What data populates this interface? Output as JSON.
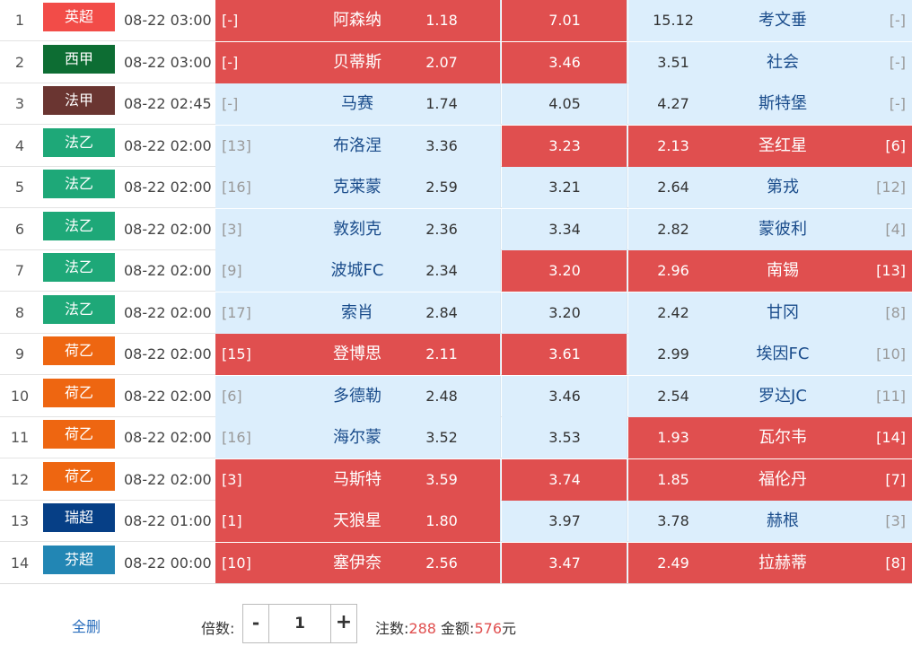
{
  "rows": [
    {
      "idx": "1",
      "league": "英超",
      "color": "#f24c48",
      "time": "08-22 03:00",
      "home_rank": "[-]",
      "home": "阿森纳",
      "home_odd": "1.18",
      "draw_odd": "7.01",
      "away_odd": "15.12",
      "away": "考文垂",
      "away_rank": "[-]",
      "sel_home": true,
      "sel_draw": true,
      "sel_away": false
    },
    {
      "idx": "2",
      "league": "西甲",
      "color": "#0d6d33",
      "time": "08-22 03:00",
      "home_rank": "[-]",
      "home": "贝蒂斯",
      "home_odd": "2.07",
      "draw_odd": "3.46",
      "away_odd": "3.51",
      "away": "社会",
      "away_rank": "[-]",
      "sel_home": true,
      "sel_draw": true,
      "sel_away": false
    },
    {
      "idx": "3",
      "league": "法甲",
      "color": "#6a3531",
      "time": "08-22 02:45",
      "home_rank": "[-]",
      "home": "马赛",
      "home_odd": "1.74",
      "draw_odd": "4.05",
      "away_odd": "4.27",
      "away": "斯特堡",
      "away_rank": "[-]",
      "sel_home": false,
      "sel_draw": false,
      "sel_away": false
    },
    {
      "idx": "4",
      "league": "法乙",
      "color": "#1ea878",
      "time": "08-22 02:00",
      "home_rank": "[13]",
      "home": "布洛涅",
      "home_odd": "3.36",
      "draw_odd": "3.23",
      "away_odd": "2.13",
      "away": "圣红星",
      "away_rank": "[6]",
      "sel_home": false,
      "sel_draw": true,
      "sel_away": true
    },
    {
      "idx": "5",
      "league": "法乙",
      "color": "#1ea878",
      "time": "08-22 02:00",
      "home_rank": "[16]",
      "home": "克莱蒙",
      "home_odd": "2.59",
      "draw_odd": "3.21",
      "away_odd": "2.64",
      "away": "第戎",
      "away_rank": "[12]",
      "sel_home": false,
      "sel_draw": false,
      "sel_away": false
    },
    {
      "idx": "6",
      "league": "法乙",
      "color": "#1ea878",
      "time": "08-22 02:00",
      "home_rank": "[3]",
      "home": "敦刻克",
      "home_odd": "2.36",
      "draw_odd": "3.34",
      "away_odd": "2.82",
      "away": "蒙彼利",
      "away_rank": "[4]",
      "sel_home": false,
      "sel_draw": false,
      "sel_away": false
    },
    {
      "idx": "7",
      "league": "法乙",
      "color": "#1ea878",
      "time": "08-22 02:00",
      "home_rank": "[9]",
      "home": "波城FC",
      "home_odd": "2.34",
      "draw_odd": "3.20",
      "away_odd": "2.96",
      "away": "南锡",
      "away_rank": "[13]",
      "sel_home": false,
      "sel_draw": true,
      "sel_away": true
    },
    {
      "idx": "8",
      "league": "法乙",
      "color": "#1ea878",
      "time": "08-22 02:00",
      "home_rank": "[17]",
      "home": "索肖",
      "home_odd": "2.84",
      "draw_odd": "3.20",
      "away_odd": "2.42",
      "away": "甘冈",
      "away_rank": "[8]",
      "sel_home": false,
      "sel_draw": false,
      "sel_away": false
    },
    {
      "idx": "9",
      "league": "荷乙",
      "color": "#ee6611",
      "time": "08-22 02:00",
      "home_rank": "[15]",
      "home": "登博思",
      "home_odd": "2.11",
      "draw_odd": "3.61",
      "away_odd": "2.99",
      "away": "埃因FC",
      "away_rank": "[10]",
      "sel_home": true,
      "sel_draw": true,
      "sel_away": false
    },
    {
      "idx": "10",
      "league": "荷乙",
      "color": "#ee6611",
      "time": "08-22 02:00",
      "home_rank": "[6]",
      "home": "多德勒",
      "home_odd": "2.48",
      "draw_odd": "3.46",
      "away_odd": "2.54",
      "away": "罗达JC",
      "away_rank": "[11]",
      "sel_home": false,
      "sel_draw": false,
      "sel_away": false
    },
    {
      "idx": "11",
      "league": "荷乙",
      "color": "#ee6611",
      "time": "08-22 02:00",
      "home_rank": "[16]",
      "home": "海尔蒙",
      "home_odd": "3.52",
      "draw_odd": "3.53",
      "away_odd": "1.93",
      "away": "瓦尔韦",
      "away_rank": "[14]",
      "sel_home": false,
      "sel_draw": false,
      "sel_away": true
    },
    {
      "idx": "12",
      "league": "荷乙",
      "color": "#ee6611",
      "time": "08-22 02:00",
      "home_rank": "[3]",
      "home": "马斯特",
      "home_odd": "3.59",
      "draw_odd": "3.74",
      "away_odd": "1.85",
      "away": "福伦丹",
      "away_rank": "[7]",
      "sel_home": true,
      "sel_draw": true,
      "sel_away": true
    },
    {
      "idx": "13",
      "league": "瑞超",
      "color": "#063f86",
      "time": "08-22 01:00",
      "home_rank": "[1]",
      "home": "天狼星",
      "home_odd": "1.80",
      "draw_odd": "3.97",
      "away_odd": "3.78",
      "away": "赫根",
      "away_rank": "[3]",
      "sel_home": true,
      "sel_draw": false,
      "sel_away": false
    },
    {
      "idx": "14",
      "league": "芬超",
      "color": "#2286b4",
      "time": "08-22 00:00",
      "home_rank": "[10]",
      "home": "塞伊奈",
      "home_odd": "2.56",
      "draw_odd": "3.47",
      "away_odd": "2.49",
      "away": "拉赫蒂",
      "away_rank": "[8]",
      "sel_home": true,
      "sel_draw": true,
      "sel_away": true
    }
  ],
  "footer": {
    "clear_label": "全删",
    "multiplier_label": "倍数:",
    "minus_label": "-",
    "multiplier_value": "1",
    "plus_label": "+",
    "bets_label": "注数:",
    "bets_value": "288",
    "amount_label": "金额:",
    "amount_value": "576",
    "amount_unit": "元"
  }
}
